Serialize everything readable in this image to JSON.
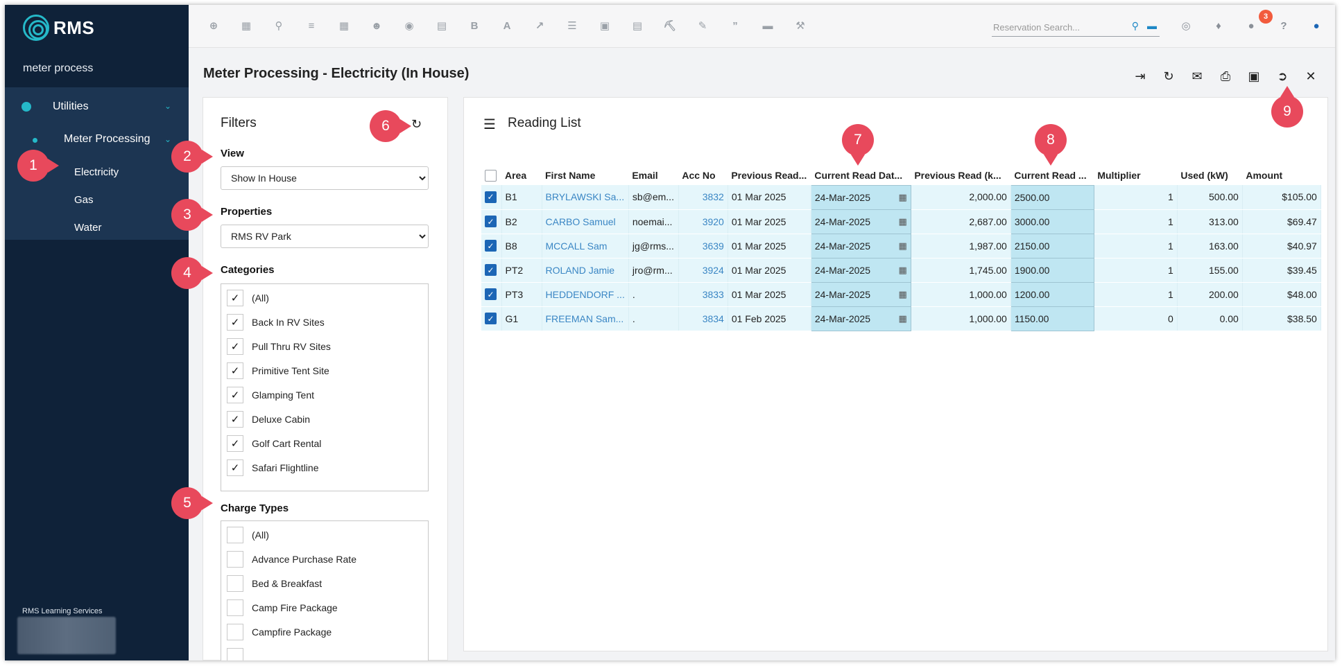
{
  "sidebar": {
    "logo_text": "RMS",
    "search_term": "meter process",
    "nav_group": {
      "label": "Utilities"
    },
    "nav_item": {
      "label": "Meter Processing"
    },
    "sub_items": [
      "Electricity",
      "Gas",
      "Water"
    ],
    "footer": "RMS Learning Services"
  },
  "topbar": {
    "icons": [
      "plus-icon",
      "calendar-icon",
      "search-icon",
      "sliders-icon",
      "grid-icon",
      "people-icon",
      "map-pin-icon",
      "map-icon",
      "bold-b-icon",
      "font-a-icon",
      "chart-line-icon",
      "checklist-icon",
      "card-icon",
      "document-icon",
      "cart-icon",
      "card-edit-icon",
      "quote-icon",
      "bed-icon",
      "hammer-icon"
    ],
    "search_placeholder": "Reservation Search...",
    "notification_count": "3"
  },
  "page": {
    "title": "Meter Processing - Electricity (In House)"
  },
  "filters": {
    "title": "Filters",
    "view_label": "View",
    "view_value": "Show In House",
    "properties_label": "Properties",
    "properties_value": "RMS RV Park",
    "categories_label": "Categories",
    "categories": [
      "(All)",
      "Back In RV Sites",
      "Pull Thru RV Sites",
      "Primitive Tent Site",
      "Glamping Tent",
      "Deluxe Cabin",
      "Golf Cart Rental",
      "Safari Flightline"
    ],
    "charge_types_label": "Charge Types",
    "charge_types": [
      "(All)",
      "Advance Purchase Rate",
      "Bed & Breakfast",
      "Camp Fire Package",
      "Campfire Package"
    ]
  },
  "reading_list": {
    "title": "Reading List",
    "columns": [
      "Area",
      "First Name",
      "Email",
      "Acc No",
      "Previous Read...",
      "Current Read Dat...",
      "Previous Read (k...",
      "Current Read ...",
      "Multiplier",
      "Used (kW)",
      "Amount"
    ],
    "rows": [
      {
        "area": "B1",
        "first_name": "BRYLAWSKI Sa...",
        "email": "sb@em...",
        "acc": "3832",
        "prev_date": "01 Mar 2025",
        "cur_date": "24-Mar-2025",
        "prev_read": "2,000.00",
        "cur_read": "2500.00",
        "mult": "1",
        "used": "500.00",
        "amount": "$105.00"
      },
      {
        "area": "B2",
        "first_name": "CARBO Samuel",
        "email": "noemai...",
        "acc": "3920",
        "prev_date": "01 Mar 2025",
        "cur_date": "24-Mar-2025",
        "prev_read": "2,687.00",
        "cur_read": "3000.00",
        "mult": "1",
        "used": "313.00",
        "amount": "$69.47"
      },
      {
        "area": "B8",
        "first_name": "MCCALL Sam",
        "email": "jg@rms...",
        "acc": "3639",
        "prev_date": "01 Mar 2025",
        "cur_date": "24-Mar-2025",
        "prev_read": "1,987.00",
        "cur_read": "2150.00",
        "mult": "1",
        "used": "163.00",
        "amount": "$40.97"
      },
      {
        "area": "PT2",
        "first_name": "ROLAND Jamie",
        "email": "jro@rm...",
        "acc": "3924",
        "prev_date": "01 Mar 2025",
        "cur_date": "24-Mar-2025",
        "prev_read": "1,745.00",
        "cur_read": "1900.00",
        "mult": "1",
        "used": "155.00",
        "amount": "$39.45"
      },
      {
        "area": "PT3",
        "first_name": "HEDDENDORF ...",
        "email": ".",
        "acc": "3833",
        "prev_date": "01 Mar 2025",
        "cur_date": "24-Mar-2025",
        "prev_read": "1,000.00",
        "cur_read": "1200.00",
        "mult": "1",
        "used": "200.00",
        "amount": "$48.00"
      },
      {
        "area": "G1",
        "first_name": "FREEMAN Sam...",
        "email": ".",
        "acc": "3834",
        "prev_date": "01 Feb 2025",
        "cur_date": "24-Mar-2025",
        "prev_read": "1,000.00",
        "cur_read": "1150.00",
        "mult": "0",
        "used": "0.00",
        "amount": "$38.50"
      }
    ]
  },
  "callouts": [
    "1",
    "2",
    "3",
    "4",
    "5",
    "6",
    "7",
    "8",
    "9"
  ]
}
